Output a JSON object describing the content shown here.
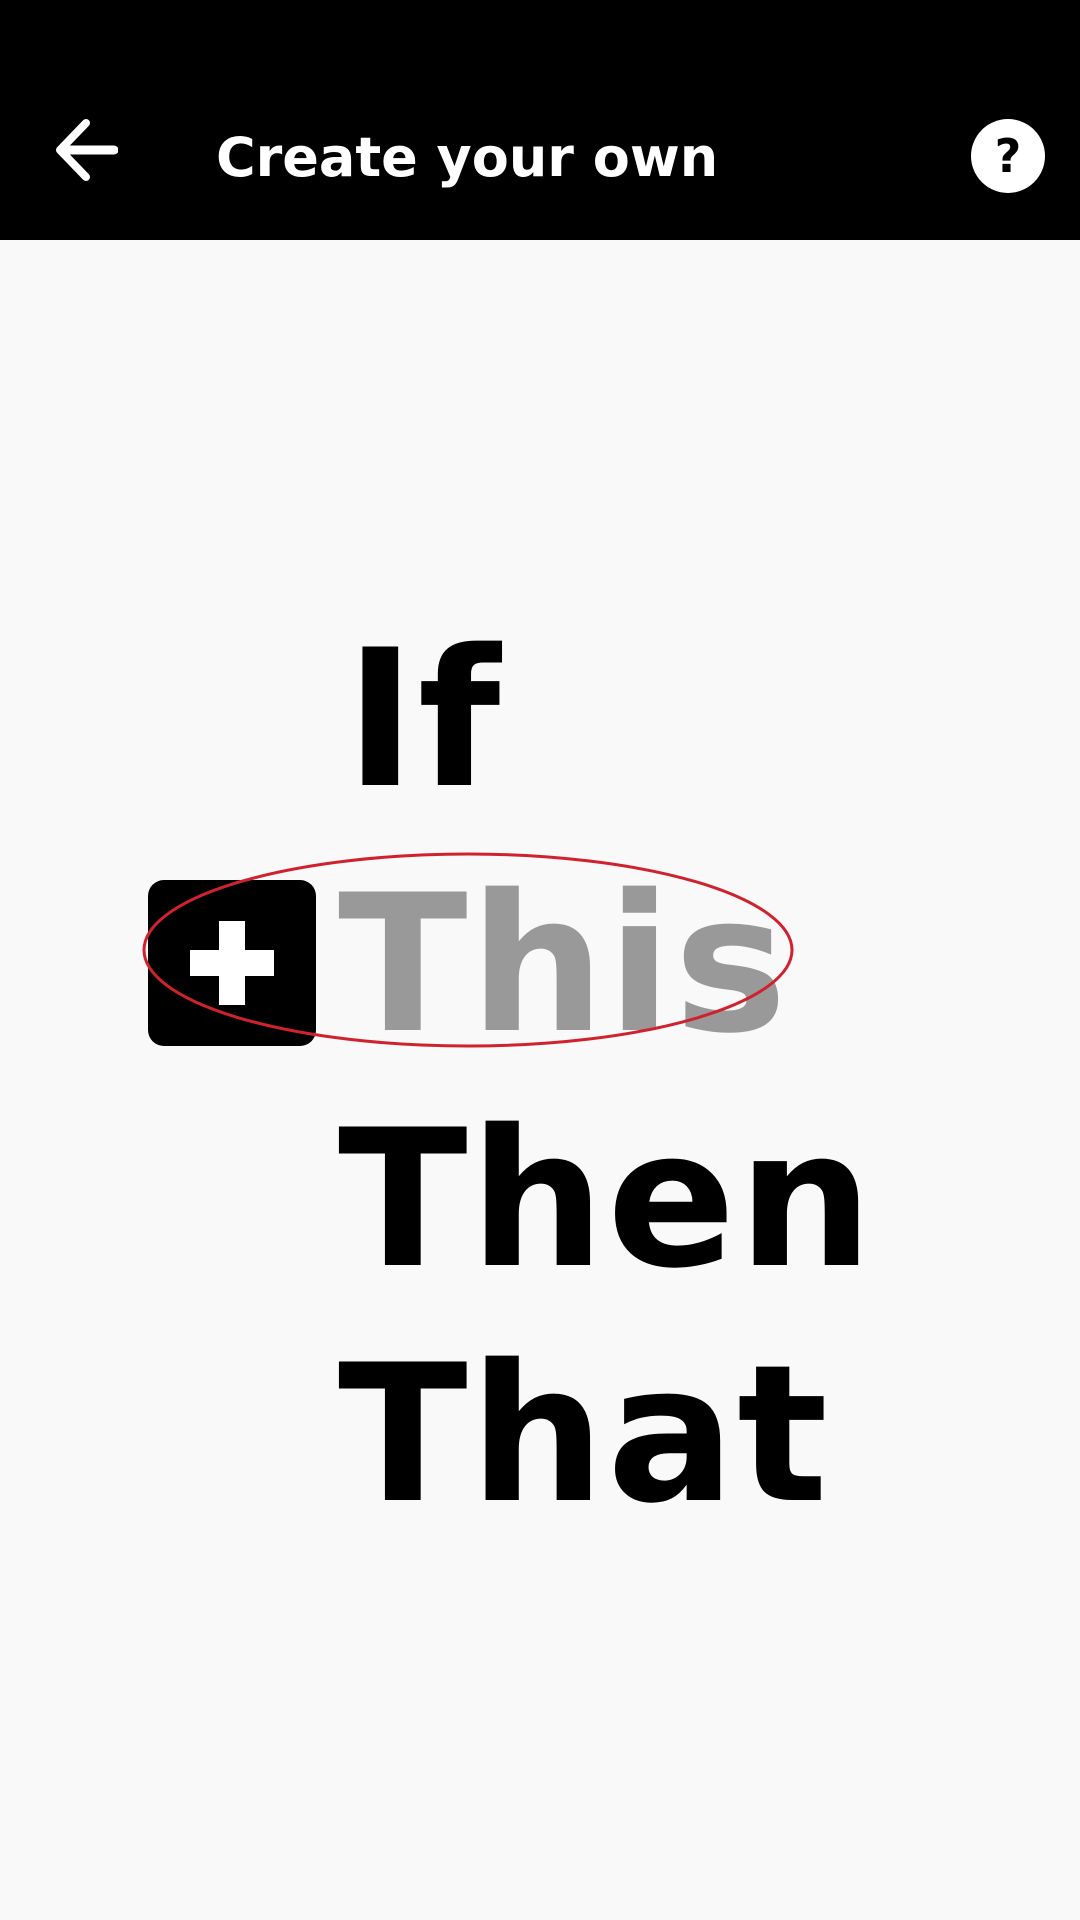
{
  "header": {
    "title": "Create your own",
    "back_icon": "arrow-left-icon",
    "help_icon": "question-mark-icon",
    "help_label": "?"
  },
  "main": {
    "if_label": "If",
    "this_label": "This",
    "then_label": "Then",
    "that_label": "That",
    "add_icon": "plus-icon"
  },
  "colors": {
    "app_bar": "#000000",
    "background": "#f9f9f9",
    "this_text": "#999999",
    "highlight": "#d0222e"
  }
}
